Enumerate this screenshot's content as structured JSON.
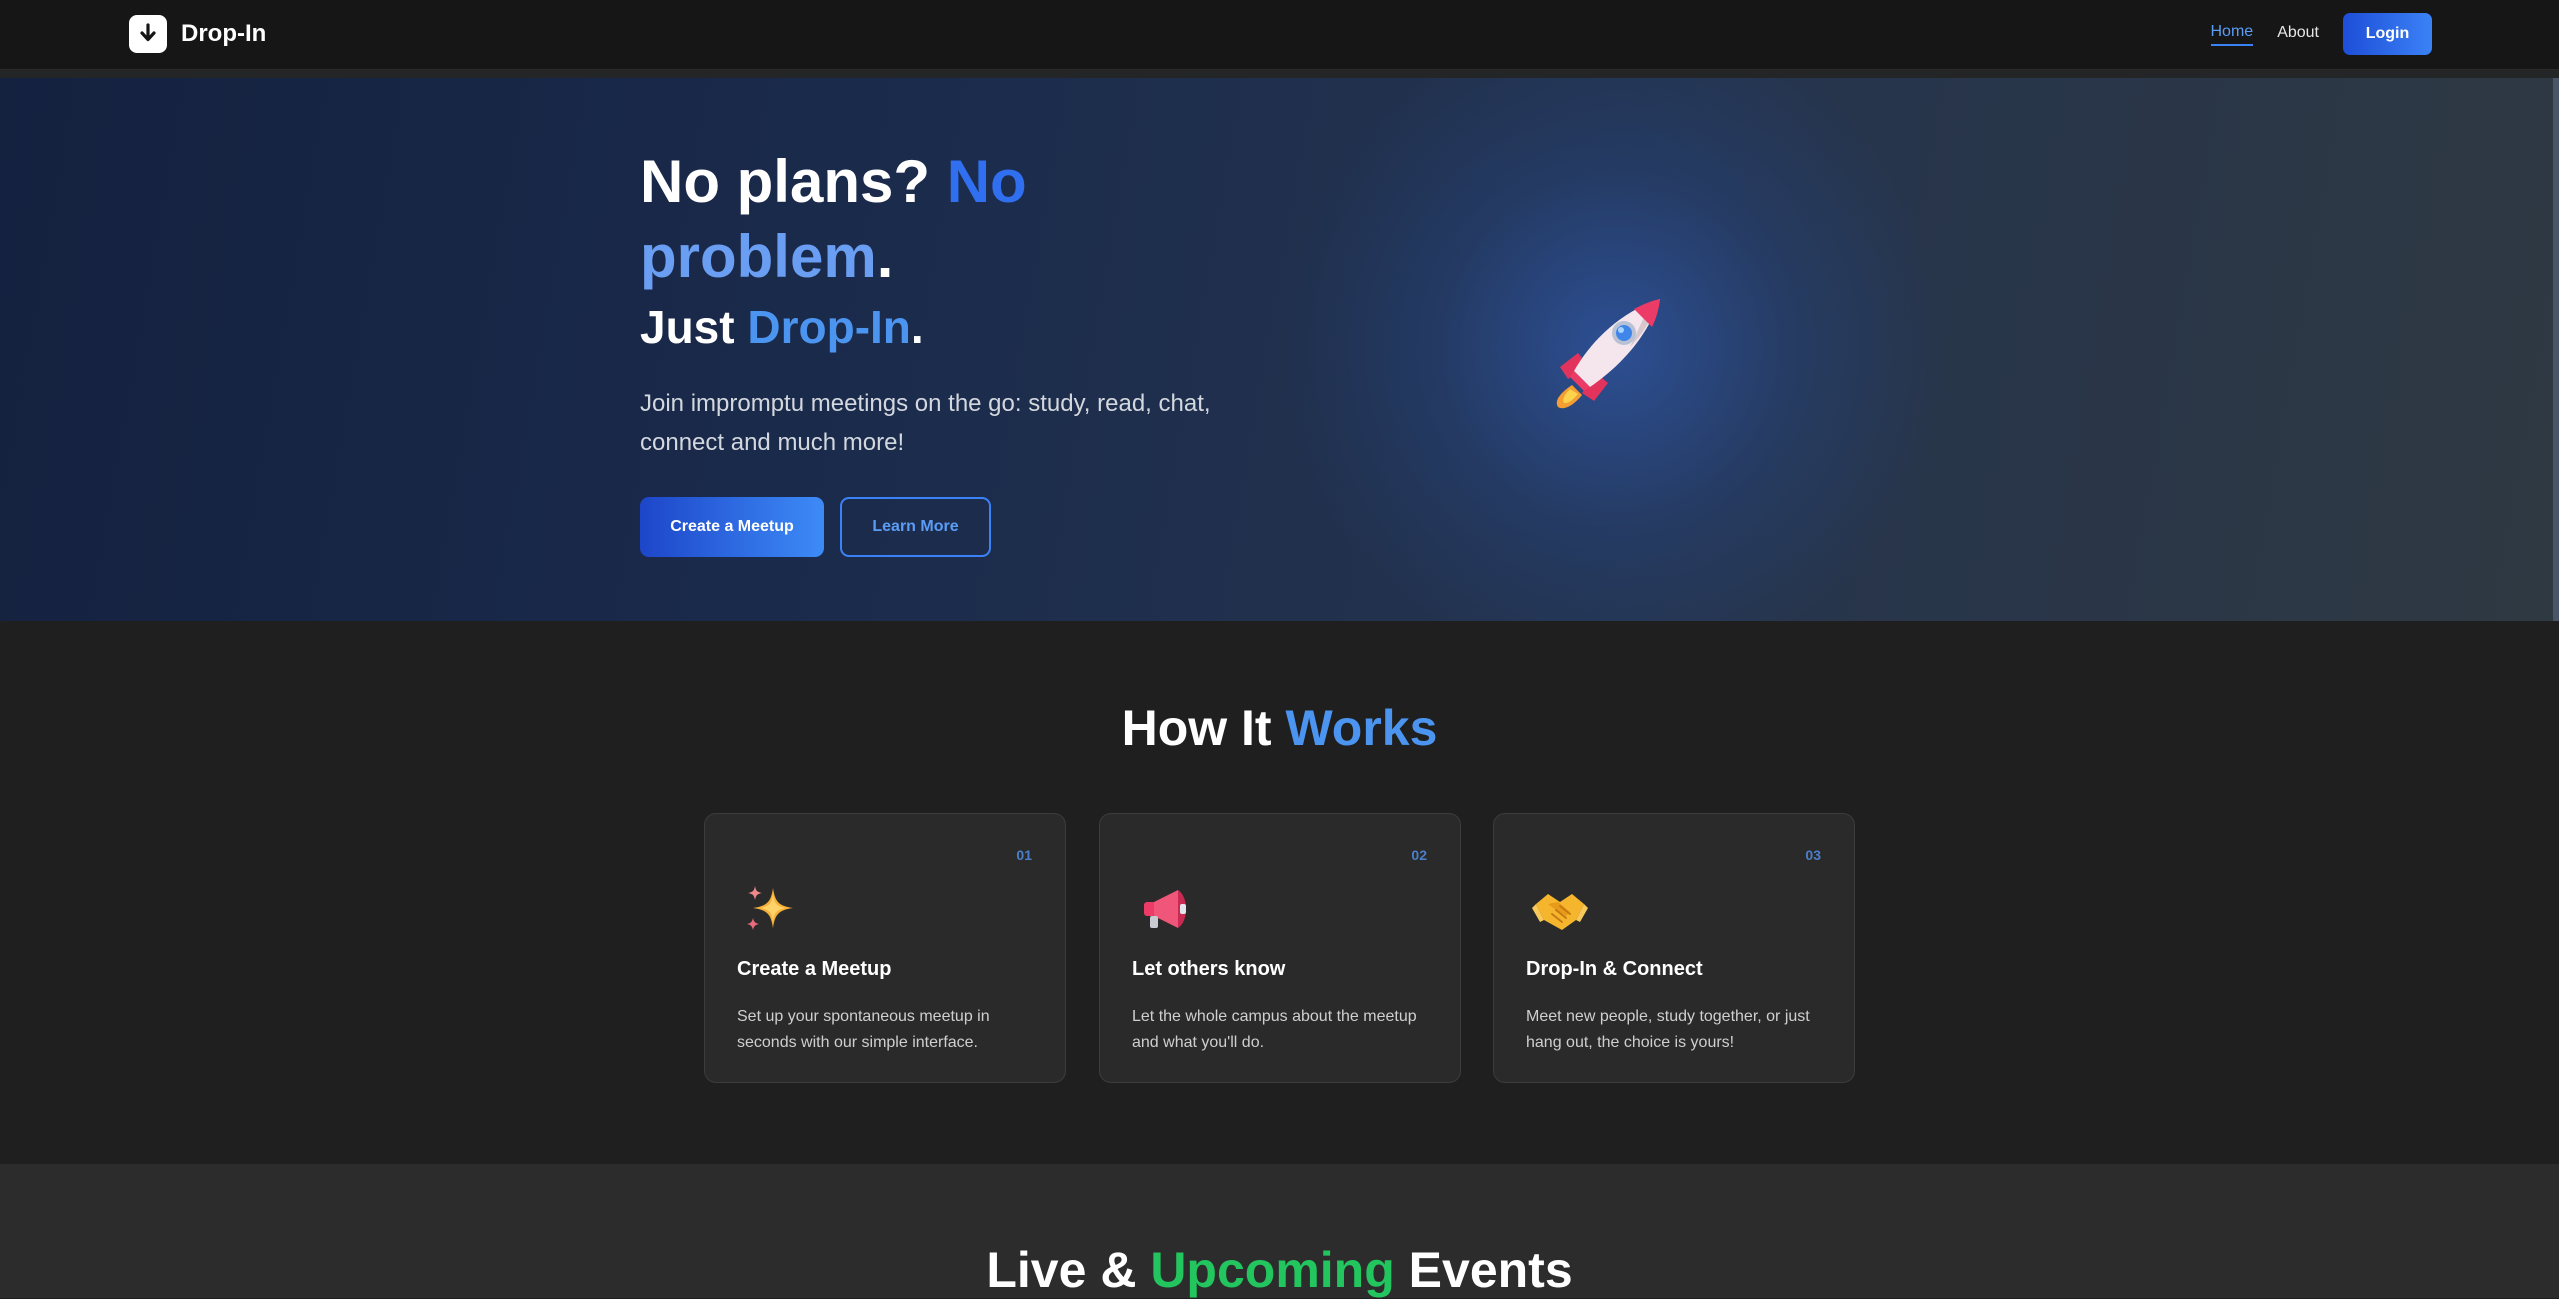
{
  "navbar": {
    "brand": "Drop-In",
    "links": [
      {
        "label": "Home",
        "active": true
      },
      {
        "label": "About",
        "active": false
      }
    ],
    "login_label": "Login"
  },
  "hero": {
    "title_part1": "No plans? ",
    "title_part2": "No",
    "title_part3": "problem",
    "title_part4": ".",
    "sub_part1": "Just ",
    "sub_part2": "Drop-In",
    "sub_part3": ".",
    "description": "Join impromptu meetings on the go: study, read, chat, connect and much more!",
    "primary_button": "Create a Meetup",
    "secondary_button": "Learn More",
    "illustration": "rocket-icon"
  },
  "how": {
    "title_part1": "How It ",
    "title_part2": "Works",
    "cards": [
      {
        "number": "01",
        "icon": "sparkles-icon",
        "title": "Create a Meetup",
        "description": "Set up your spontaneous meetup in seconds with our simple interface."
      },
      {
        "number": "02",
        "icon": "megaphone-icon",
        "title": "Let others know",
        "description": "Let the whole campus about the meetup and what you'll do."
      },
      {
        "number": "03",
        "icon": "handshake-icon",
        "title": "Drop-In & Connect",
        "description": "Meet new people, study together, or just hang out, the choice is yours!"
      }
    ]
  },
  "events": {
    "title_part1": "Live & ",
    "title_part2": "Upcoming",
    "title_part3": " Events"
  },
  "colors": {
    "accent_blue": "#3b82f6",
    "accent_green": "#22c55e",
    "background": "#1e1e1e"
  }
}
